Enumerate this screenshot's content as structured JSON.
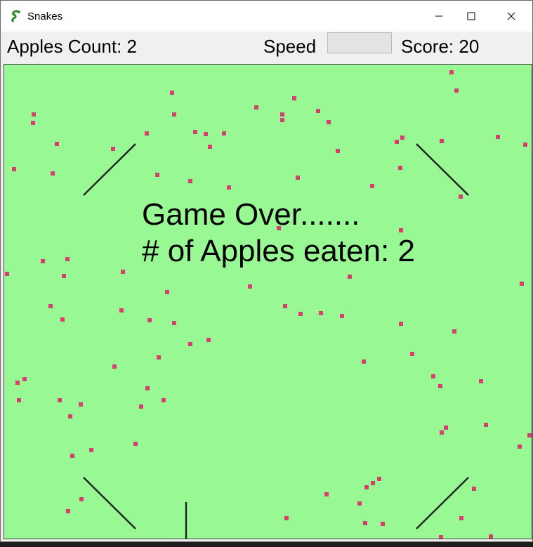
{
  "window": {
    "title": "Snakes",
    "icon": "snake-icon",
    "controls": [
      "minimize-icon",
      "maximize-icon",
      "close-icon"
    ]
  },
  "toolbar": {
    "apples_count_label": "Apples Count: 2",
    "speed_label": "Speed",
    "speed_value": "",
    "score_label": "Score: 20"
  },
  "game": {
    "board_color": "#98f893",
    "apple_color": "#d63f6e",
    "status_line1": "Game Over.......",
    "status_line2": "# of Apples eaten: 2"
  },
  "colors": {
    "title_bar": "#ffffff",
    "toolbar": "#f0f0f0",
    "board": "#98f893",
    "apple": "#d63f6e",
    "obstacle": "#222222"
  }
}
